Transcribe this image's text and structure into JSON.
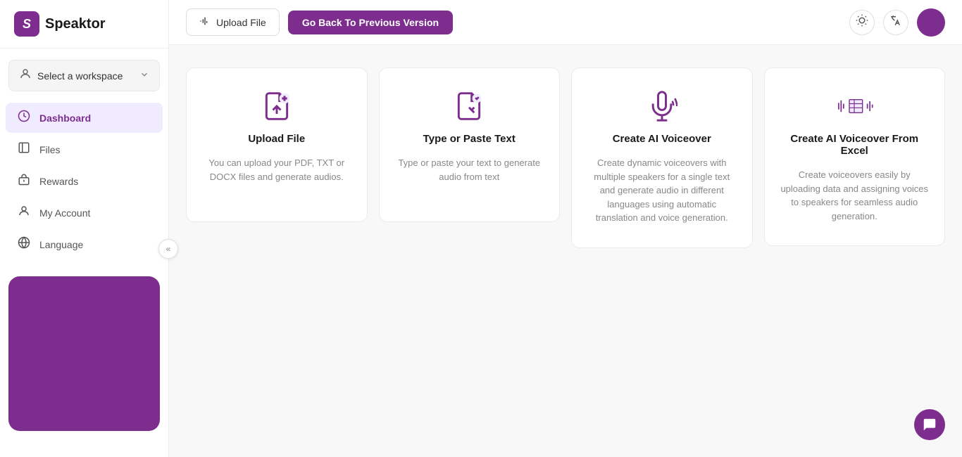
{
  "logo": {
    "icon_letter": "S",
    "text": "Speaktor"
  },
  "sidebar": {
    "workspace_label": "Select a workspace",
    "workspace_icon": "workspace-icon",
    "chevron": "▾",
    "nav_items": [
      {
        "id": "dashboard",
        "label": "Dashboard",
        "icon": "dashboard-icon",
        "active": true
      },
      {
        "id": "files",
        "label": "Files",
        "icon": "files-icon",
        "active": false
      },
      {
        "id": "rewards",
        "label": "Rewards",
        "icon": "rewards-icon",
        "active": false
      },
      {
        "id": "my-account",
        "label": "My Account",
        "icon": "account-icon",
        "active": false
      },
      {
        "id": "language",
        "label": "Language",
        "icon": "language-icon",
        "active": false
      }
    ],
    "collapse_label": "«"
  },
  "topbar": {
    "upload_label": "Upload File",
    "go_back_label": "Go Back To Previous Version",
    "theme_icon": "sun-icon",
    "translate_icon": "translate-icon"
  },
  "cards": [
    {
      "id": "upload-file",
      "title": "Upload File",
      "description": "You can upload your PDF, TXT or DOCX files and generate audios.",
      "icon": "upload-file-icon"
    },
    {
      "id": "type-paste",
      "title": "Type or Paste Text",
      "description": "Type or paste your text to generate audio from text",
      "icon": "type-paste-icon"
    },
    {
      "id": "ai-voiceover",
      "title": "Create AI Voiceover",
      "description": "Create dynamic voiceovers with multiple speakers for a single text and generate audio in different languages using automatic translation and voice generation.",
      "icon": "voiceover-icon"
    },
    {
      "id": "ai-voiceover-excel",
      "title": "Create AI Voiceover From Excel",
      "description": "Create voiceovers easily by uploading data and assigning voices to speakers for seamless audio generation.",
      "icon": "voiceover-excel-icon"
    }
  ],
  "colors": {
    "brand": "#7c2d8e",
    "brand_light": "#f0ebff"
  }
}
